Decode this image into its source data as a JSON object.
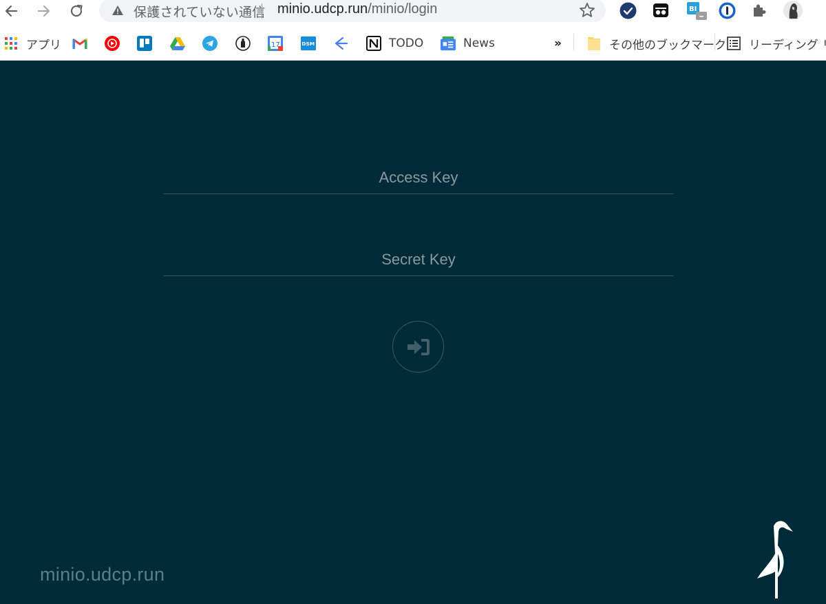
{
  "browser": {
    "omnibox": {
      "security_status": "保護されていない通信",
      "url_host": "minio.udcp.run",
      "url_path": "/minio/login"
    },
    "bookmarks_bar": {
      "items": [
        {
          "label": "アプリ",
          "icon": "apps-grid-icon"
        },
        {
          "label": "",
          "icon": "gmail-icon"
        },
        {
          "label": "",
          "icon": "youtube-music-icon"
        },
        {
          "label": "",
          "icon": "trello-icon"
        },
        {
          "label": "",
          "icon": "google-drive-icon"
        },
        {
          "label": "",
          "icon": "telegram-icon"
        },
        {
          "label": "",
          "icon": "bottle-icon"
        },
        {
          "label": "",
          "icon": "google-calendar-icon"
        },
        {
          "label": "",
          "icon": "dsm-icon"
        },
        {
          "label": "",
          "icon": "arrow-fork-icon"
        },
        {
          "label": "TODO",
          "icon": "notion-icon"
        },
        {
          "label": "News",
          "icon": "google-news-icon"
        }
      ],
      "overflow": "»",
      "other_bookmarks": "その他のブックマーク",
      "reading_list": "リーディング リスト"
    },
    "calendar_icon_text": "17",
    "dsm_icon_text": "DSM",
    "bi_badge_text": "BI"
  },
  "login": {
    "access_key_placeholder": "Access Key",
    "secret_key_placeholder": "Secret Key",
    "host_label": "minio.udcp.run"
  },
  "colors": {
    "page_background": "#002a37",
    "field_underline": "#3c5761",
    "placeholder": "#8b9aa0",
    "host_text": "#5a7f8c"
  }
}
